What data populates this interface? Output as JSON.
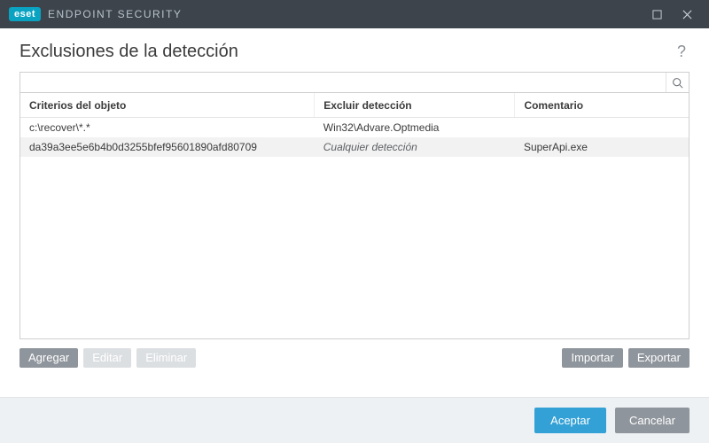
{
  "titlebar": {
    "brand_badge": "eset",
    "product": "ENDPOINT SECURITY"
  },
  "header": {
    "title": "Exclusiones de la detección",
    "help_symbol": "?"
  },
  "search": {
    "value": ""
  },
  "table": {
    "columns": {
      "c1": "Criterios del objeto",
      "c2": "Excluir detección",
      "c3": "Comentario"
    },
    "rows": [
      {
        "criteria": "c:\\recover\\*.*",
        "exclude": "Win32\\Advare.Optmedia",
        "exclude_italic": false,
        "comment": ""
      },
      {
        "criteria": "da39a3ee5e6b4b0d3255bfef95601890afd80709",
        "exclude": "Cualquier detección",
        "exclude_italic": true,
        "comment": "SuperApi.exe"
      }
    ]
  },
  "toolbar": {
    "add": "Agregar",
    "edit": "Editar",
    "delete": "Eliminar",
    "import": "Importar",
    "export": "Exportar"
  },
  "footer": {
    "accept": "Aceptar",
    "cancel": "Cancelar"
  }
}
